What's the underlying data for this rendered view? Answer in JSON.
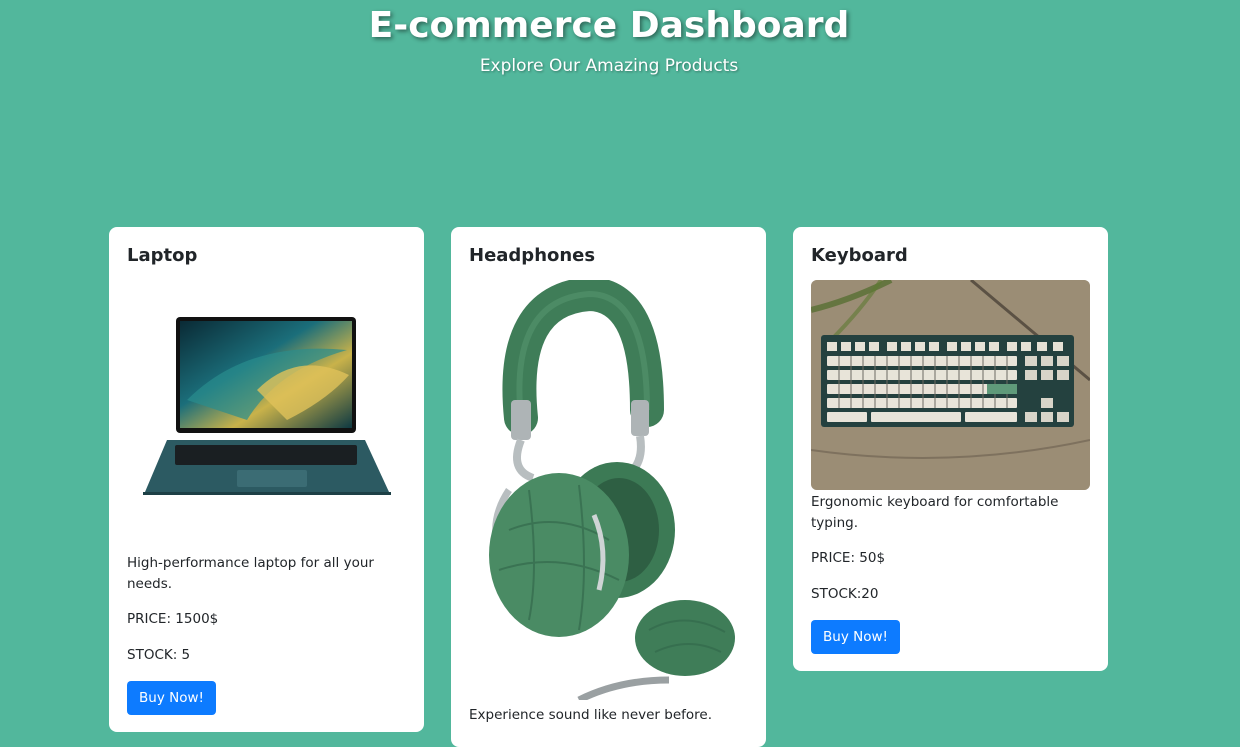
{
  "header": {
    "title": "E-commerce Dashboard",
    "subtitle": "Explore Our Amazing Products"
  },
  "colors": {
    "background": "#52b79c",
    "button": "#0d7bff",
    "card": "#ffffff"
  },
  "products": [
    {
      "name": "Laptop",
      "image_icon": "laptop-image",
      "description": "High-performance laptop for all your needs.",
      "price": "PRICE: 1500$",
      "stock": "STOCK: 5",
      "button_label": "Buy Now!"
    },
    {
      "name": "Headphones",
      "image_icon": "headphones-image",
      "description": "Experience sound like never before."
    },
    {
      "name": "Keyboard",
      "image_icon": "keyboard-image",
      "description": "Ergonomic keyboard for comfortable typing.",
      "price": "PRICE: 50$",
      "stock": "STOCK:20",
      "button_label": "Buy Now!"
    }
  ]
}
